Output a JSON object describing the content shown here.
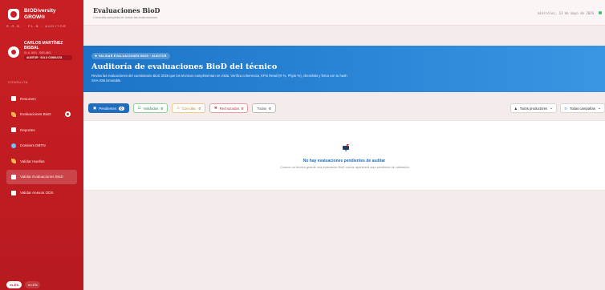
{
  "brand": {
    "name_line1": "BIODiversity",
    "name_line2": "GROW®",
    "sub": "S.G.B. · PL.B · AUDITOR"
  },
  "profile": {
    "name": "CARLOS MARTÍNEZ BISBAL",
    "id": "D.I.A. 0021 · SGR-4801",
    "role": "AUDITOR · SOLO CONSULTA"
  },
  "sidebar": {
    "section_label": "CONSULTA",
    "items": [
      {
        "label": "Resumen",
        "icon": "chart-icon"
      },
      {
        "label": "Evaluaciones BioD",
        "icon": "leaf-icon",
        "badge": true
      },
      {
        "label": "Reportes",
        "icon": "document-icon"
      },
      {
        "label": "Dossiers DBTN",
        "icon": "globe-icon"
      },
      {
        "label": "Validar Huellas",
        "icon": "leaf-icon"
      },
      {
        "label": "Validar Evaluaciones BioD",
        "icon": "document-icon",
        "active": true
      },
      {
        "label": "Validar Anexos ODS",
        "icon": "document-icon"
      }
    ],
    "languages": [
      "es-ES",
      "en-EN"
    ]
  },
  "header": {
    "title": "Evaluaciones BioD",
    "subtitle": "Consulta completa de todas las evaluaciones",
    "date": "miércoles, 13 de mayo de 2026"
  },
  "hero": {
    "pill": "❖ VALIDAR EVALUACIONES BIOD · AUDITOR",
    "title": "Auditoría de evaluaciones BioD del técnico",
    "description": "Revisa las evaluaciones del cuestionario BioD 2026 que los técnicos cumplimentan en visita. Verifica coherencia, KPIs Retail (R %, Phyto %), checklists y firma con tu hash SHA-256 inmutable."
  },
  "filters": [
    {
      "label": "Pendientes",
      "count": "0",
      "style": "blue",
      "icon": "▣"
    },
    {
      "label": "Validadas",
      "count": "0",
      "style": "green",
      "icon": "☑"
    },
    {
      "label": "Con obs.",
      "count": "0",
      "style": "amber",
      "icon": "⚠"
    },
    {
      "label": "Rechazadas",
      "count": "0",
      "style": "red",
      "icon": "✖"
    },
    {
      "label": "Todas",
      "count": "0",
      "style": "gray",
      "icon": ""
    }
  ],
  "selects": [
    {
      "value": "Todos productores",
      "icon": "♟"
    },
    {
      "value": "Todas campañas",
      "icon": "☷"
    }
  ],
  "empty_state": {
    "title": "No hay evaluaciones pendientes de auditar",
    "text": "Cuando un técnico guarde una evaluación BioD nueva, aparecerá aquí pendiente de validación."
  },
  "colors": {
    "sidebar": "#c81f24",
    "accent": "#1f6dbf",
    "hero": "#2b86d8"
  }
}
